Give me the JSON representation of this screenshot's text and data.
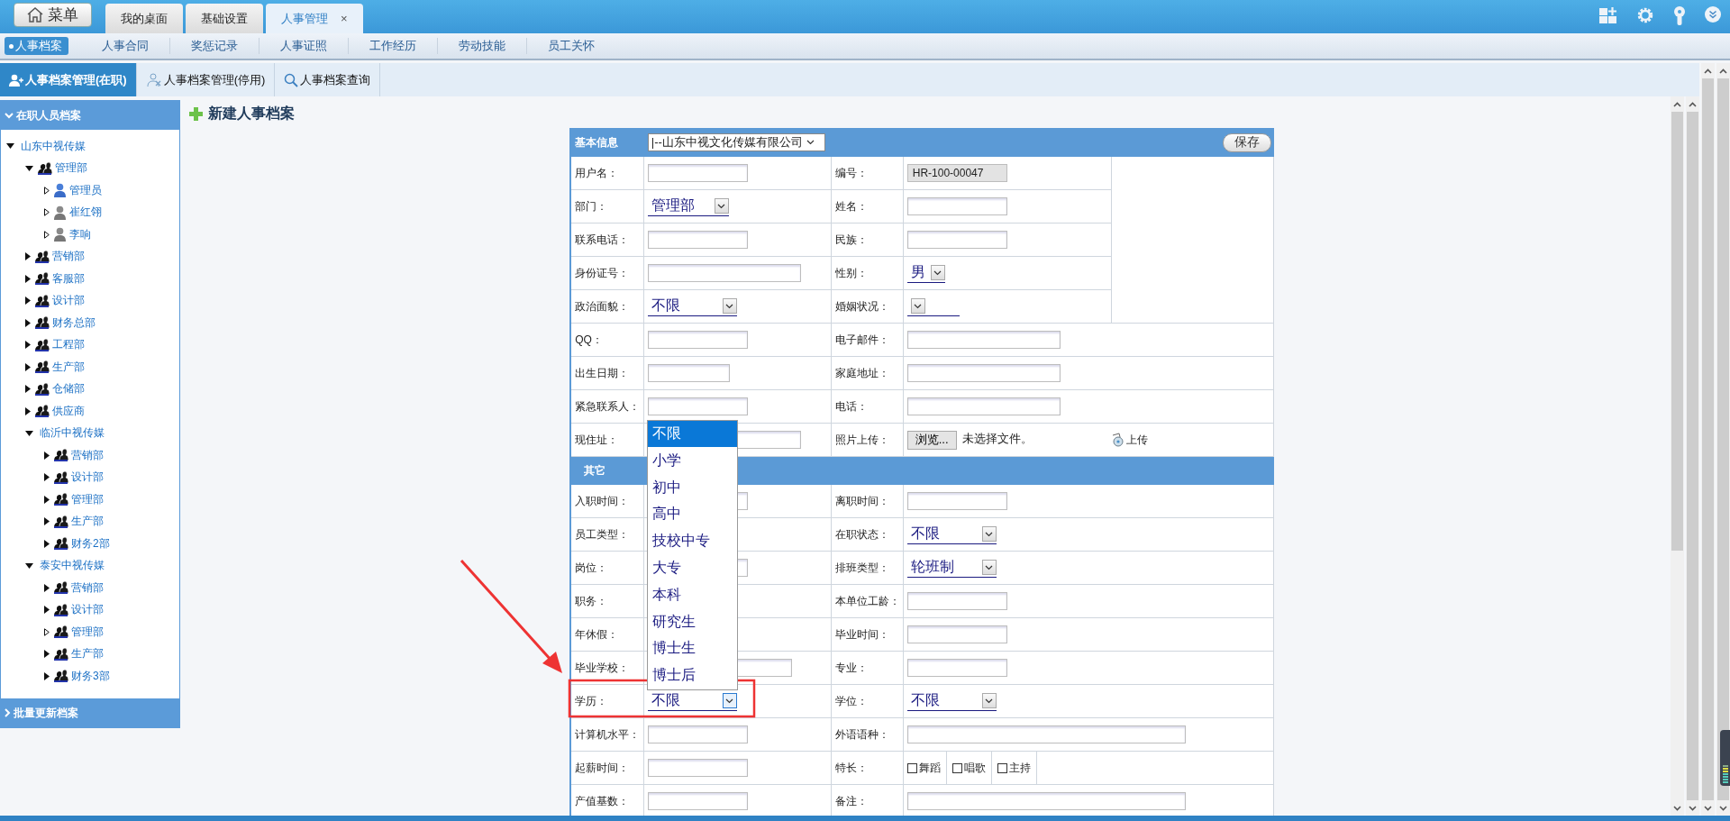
{
  "header": {
    "menu_button": "菜单",
    "tabs": [
      {
        "label": "我的桌面",
        "selected": false
      },
      {
        "label": "基础设置",
        "selected": false
      },
      {
        "label": "人事管理",
        "selected": true,
        "close": "×"
      }
    ]
  },
  "nav": [
    {
      "label": "人事档案",
      "selected": true
    },
    {
      "label": "人事合同",
      "selected": false
    },
    {
      "label": "奖惩记录",
      "selected": false
    },
    {
      "label": "人事证照",
      "selected": false
    },
    {
      "label": "工作经历",
      "selected": false
    },
    {
      "label": "劳动技能",
      "selected": false
    },
    {
      "label": "员工关怀",
      "selected": false
    }
  ],
  "subtabs": [
    {
      "label": "人事档案管理(在职)",
      "kind": "user",
      "selected": true
    },
    {
      "label": "人事档案管理(停用)",
      "kind": "disabled-user",
      "selected": false
    },
    {
      "label": "人事档案查询",
      "kind": "search",
      "selected": false
    }
  ],
  "sidebar": {
    "title": "在职人员档案",
    "footer": "批量更新档案",
    "tree": [
      {
        "label": "山东中视传媒",
        "expanded": true,
        "expandable": true,
        "children": [
          {
            "label": "管理部",
            "kind": "dept",
            "expanded": true,
            "expandable": true,
            "children": [
              {
                "label": "管理员",
                "kind": "admin",
                "expanded": false,
                "expandable": false
              },
              {
                "label": "崔红翎",
                "kind": "user",
                "expanded": false,
                "expandable": false
              },
              {
                "label": "李响",
                "kind": "user",
                "expanded": false,
                "expandable": false
              }
            ]
          },
          {
            "label": "营销部",
            "kind": "dept",
            "expanded": false,
            "expandable": true
          },
          {
            "label": "客服部",
            "kind": "dept",
            "expanded": false,
            "expandable": true
          },
          {
            "label": "设计部",
            "kind": "dept",
            "expanded": false,
            "expandable": true
          },
          {
            "label": "财务总部",
            "kind": "dept",
            "expanded": false,
            "expandable": true
          },
          {
            "label": "工程部",
            "kind": "dept",
            "expanded": false,
            "expandable": true
          },
          {
            "label": "生产部",
            "kind": "dept",
            "expanded": false,
            "expandable": true
          },
          {
            "label": "仓储部",
            "kind": "dept",
            "expanded": false,
            "expandable": true
          },
          {
            "label": "供应商",
            "kind": "dept",
            "expanded": false,
            "expandable": true
          },
          {
            "label": "临沂中视传媒",
            "expanded": true,
            "expandable": true,
            "children": [
              {
                "label": "营销部",
                "kind": "dept",
                "expanded": false,
                "expandable": true
              },
              {
                "label": "设计部",
                "kind": "dept",
                "expanded": false,
                "expandable": true
              },
              {
                "label": "管理部",
                "kind": "dept",
                "expanded": false,
                "expandable": true
              },
              {
                "label": "生产部",
                "kind": "dept",
                "expanded": false,
                "expandable": true
              },
              {
                "label": "财务2部",
                "kind": "dept",
                "expanded": false,
                "expandable": true
              }
            ]
          },
          {
            "label": "泰安中视传媒",
            "expanded": true,
            "expandable": true,
            "children": [
              {
                "label": "营销部",
                "kind": "dept",
                "expanded": false,
                "expandable": true
              },
              {
                "label": "设计部",
                "kind": "dept",
                "expanded": false,
                "expandable": true
              },
              {
                "label": "管理部",
                "kind": "dept",
                "expanded": false,
                "expandable": false
              },
              {
                "label": "生产部",
                "kind": "dept",
                "expanded": false,
                "expandable": true
              },
              {
                "label": "财务3部",
                "kind": "dept",
                "expanded": false,
                "expandable": true
              }
            ]
          }
        ]
      }
    ]
  },
  "page_title": "新建人事档案",
  "form": {
    "title": "基本信息",
    "company": "|--山东中视文化传媒有限公司",
    "save": "保存",
    "basic_rows": [
      {
        "left": {
          "label": "用户名：",
          "field": {
            "kind": "input"
          }
        },
        "right": {
          "label": "编号：",
          "field": {
            "kind": "input",
            "readonly": true,
            "value": "HR-100-00047"
          }
        }
      },
      {
        "left": {
          "label": "部门：",
          "field": {
            "kind": "select",
            "value": "管理部",
            "focused": false
          }
        },
        "right": {
          "label": "姓名：",
          "field": {
            "kind": "input"
          }
        }
      },
      {
        "left": {
          "label": "联系电话：",
          "field": {
            "kind": "input"
          }
        },
        "right": {
          "label": "民族：",
          "field": {
            "kind": "input"
          }
        }
      },
      {
        "left": {
          "label": "身份证号：",
          "field": {
            "kind": "input"
          }
        },
        "right": {
          "label": "性别：",
          "field": {
            "kind": "select",
            "value": "男",
            "focused": false
          }
        }
      },
      {
        "left": {
          "label": "政治面貌：",
          "field": {
            "kind": "select",
            "value": "不限",
            "focused": false
          }
        },
        "right": {
          "label": "婚姻状况：",
          "field": {
            "kind": "select",
            "focused": false
          }
        }
      },
      {
        "left": {
          "label": "QQ：",
          "field": {
            "kind": "input"
          }
        },
        "right": {
          "label": "电子邮件：",
          "field": {
            "kind": "input"
          }
        }
      },
      {
        "left": {
          "label": "出生日期：",
          "field": {
            "kind": "input"
          }
        },
        "right": {
          "label": "家庭地址：",
          "field": {
            "kind": "input"
          }
        }
      },
      {
        "left": {
          "label": "紧急联系人：",
          "field": {
            "kind": "input"
          }
        },
        "right": {
          "label": "电话：",
          "field": {
            "kind": "input"
          }
        }
      },
      {
        "left": {
          "label": "现住址：",
          "field": {
            "kind": "input"
          }
        },
        "right": {
          "label": "照片上传：",
          "field": {
            "kind": "file",
            "button": "浏览...",
            "status": "未选择文件。",
            "upload": "上传"
          }
        }
      }
    ],
    "other_title": "其它",
    "other_rows": [
      {
        "left": {
          "label": "入职时间：",
          "field": {
            "kind": "input"
          }
        },
        "right": {
          "label": "离职时间：",
          "field": {
            "kind": "input"
          }
        }
      },
      {
        "left": {
          "label": "员工类型："
        },
        "right": {
          "label": "在职状态：",
          "field": {
            "kind": "select",
            "value": "不限",
            "focused": false
          }
        }
      },
      {
        "left": {
          "label": "岗位：",
          "field": {
            "kind": "input"
          }
        },
        "right": {
          "label": "排班类型：",
          "field": {
            "kind": "select",
            "value": "轮班制",
            "focused": false
          }
        }
      },
      {
        "left": {
          "label": "职务："
        },
        "right": {
          "label": "本单位工龄：",
          "field": {
            "kind": "input"
          }
        }
      },
      {
        "left": {
          "label": "年休假："
        },
        "right": {
          "label": "毕业时间：",
          "field": {
            "kind": "input"
          }
        }
      },
      {
        "left": {
          "label": "毕业学校：",
          "field": {
            "kind": "input"
          }
        },
        "right": {
          "label": "专业：",
          "field": {
            "kind": "input"
          }
        }
      },
      {
        "left": {
          "label": "学历：",
          "field": {
            "kind": "select",
            "value": "不限",
            "focused": true,
            "expanded": true,
            "options": [
              {
                "label": "不限",
                "selected": true
              },
              {
                "label": "小学",
                "selected": false
              },
              {
                "label": "初中",
                "selected": false
              },
              {
                "label": "高中",
                "selected": false
              },
              {
                "label": "技校中专",
                "selected": false
              },
              {
                "label": "大专",
                "selected": false
              },
              {
                "label": "本科",
                "selected": false
              },
              {
                "label": "研究生",
                "selected": false
              },
              {
                "label": "博士生",
                "selected": false
              },
              {
                "label": "博士后",
                "selected": false
              }
            ]
          }
        },
        "right": {
          "label": "学位：",
          "field": {
            "kind": "select",
            "value": "不限",
            "focused": false
          }
        }
      },
      {
        "left": {
          "label": "计算机水平：",
          "field": {
            "kind": "input"
          }
        },
        "right": {
          "label": "外语语种：",
          "field": {
            "kind": "input"
          }
        }
      },
      {
        "left": {
          "label": "起薪时间：",
          "field": {
            "kind": "input"
          }
        },
        "right": {
          "label": "特长：",
          "field": {
            "kind": "checks",
            "items": [
              {
                "label": "舞蹈",
                "checked": false
              },
              {
                "label": "唱歌",
                "checked": false
              },
              {
                "label": "主持",
                "checked": false
              }
            ]
          }
        }
      },
      {
        "left": {
          "label": "产值基数：",
          "field": {
            "kind": "input"
          }
        },
        "right": {
          "label": "备注：",
          "field": {
            "kind": "input"
          }
        }
      }
    ]
  }
}
